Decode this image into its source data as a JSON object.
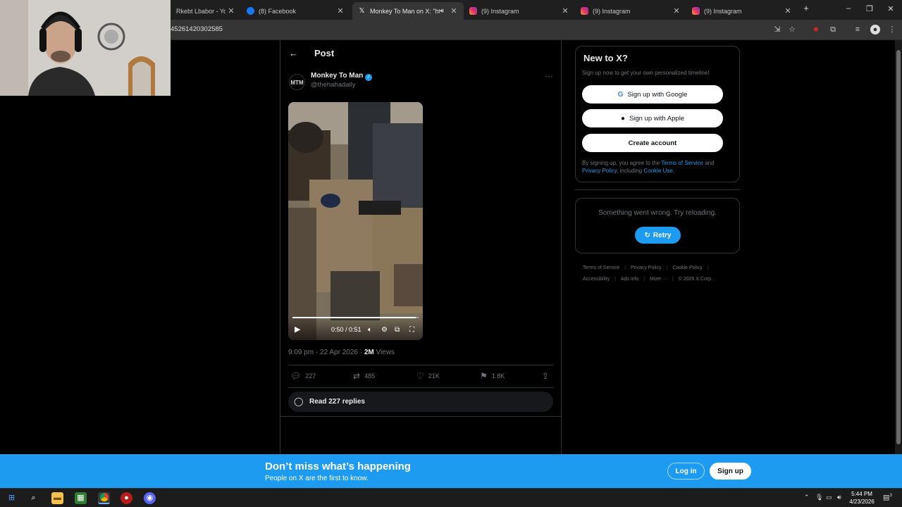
{
  "browser": {
    "tabs": [
      {
        "title": "Rkebt Lbabor - YouT",
        "favicon": "youtube-icon",
        "active": false
      },
      {
        "title": "(8) Facebook",
        "favicon": "facebook-icon",
        "active": false
      },
      {
        "title": "Monkey To Man on X: \"htt",
        "favicon": "x-icon",
        "active": true
      },
      {
        "title": "(9) Instagram",
        "favicon": "instagram-icon",
        "active": false
      },
      {
        "title": "(9) Instagram",
        "favicon": "instagram-icon",
        "active": false
      },
      {
        "title": "(9) Instagram",
        "favicon": "instagram-icon",
        "active": false
      }
    ],
    "url": "45261420302585"
  },
  "post": {
    "header_title": "Post",
    "author_name": "Monkey To Man",
    "author_handle": "@thehahadaily",
    "avatar_text": "MTM",
    "video": {
      "time": "0:50 / 0:51",
      "progress": 0.98
    },
    "time": "9:09 pm",
    "date": "22 Apr 2026",
    "views_count": "2M",
    "views_label": "Views",
    "replies": "227",
    "reposts": "485",
    "likes": "21K",
    "bookmarks": "1.8K",
    "read_replies": "Read 227 replies"
  },
  "sidebar": {
    "new_title": "New to X?",
    "new_sub": "Sign up now to get your own personalized timeline!",
    "google_label": "Sign up with Google",
    "apple_label": "Sign up with Apple",
    "create_label": "Create account",
    "legal_1": "By signing up, you agree to the",
    "terms": "Terms of Service",
    "and": "and",
    "privacy": "Privacy Policy",
    "including": ", including",
    "cookie": "Cookie Use.",
    "error_msg": "Something went wrong. Try reloading.",
    "retry": "Retry",
    "footer_links": [
      "Terms of Service",
      "Privacy Policy",
      "Cookie Policy",
      "Accessibility",
      "Ads info",
      "More ···",
      "© 2026 X Corp."
    ]
  },
  "banner": {
    "headline": "Don’t miss what’s happening",
    "sub": "People on X are the first to know.",
    "login": "Log in",
    "signup": "Sign up"
  },
  "taskbar": {
    "time": "5:44 PM",
    "date": "4/23/2026",
    "notifications": "3"
  },
  "colors": {
    "accent": "#1d9bf0",
    "background": "#000000",
    "muted": "#71767b"
  }
}
